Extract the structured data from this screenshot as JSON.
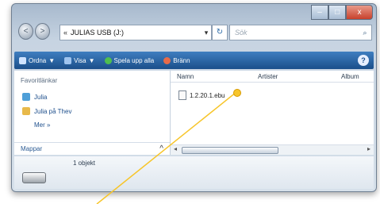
{
  "window": {
    "title_buttons": {
      "minimize": "–",
      "maximize": "□",
      "close": "x"
    }
  },
  "navigation": {
    "back": "<",
    "forward": ">",
    "address_path": "JULIAS USB (J:)",
    "address_prefix": "«",
    "search_placeholder": "Sök"
  },
  "toolbar": {
    "items": [
      {
        "label": "Ordna",
        "caret": "▼"
      },
      {
        "label": "Visa",
        "caret": "▼"
      },
      {
        "label": "Spela upp alla"
      },
      {
        "label": "Bränn"
      }
    ],
    "help": "?"
  },
  "nav_pane": {
    "header": "Favoritlänkar",
    "items": [
      {
        "label": "Julia",
        "icon": "document-icon"
      },
      {
        "label": "Julia på Thev",
        "icon": "folder-icon"
      },
      {
        "label": "Mer »",
        "icon": ""
      }
    ],
    "folders_label": "Mappar",
    "folders_caret": "^"
  },
  "content": {
    "columns": [
      "Namn",
      "Artister",
      "Album"
    ],
    "files": [
      {
        "name": "1.2.20.1.ebu"
      }
    ]
  },
  "details": {
    "count": "1 objekt"
  },
  "colors": {
    "toolbar_top": "#3f7ec0",
    "toolbar_bottom": "#1b4f8a",
    "pointer": "#f7c52a"
  }
}
